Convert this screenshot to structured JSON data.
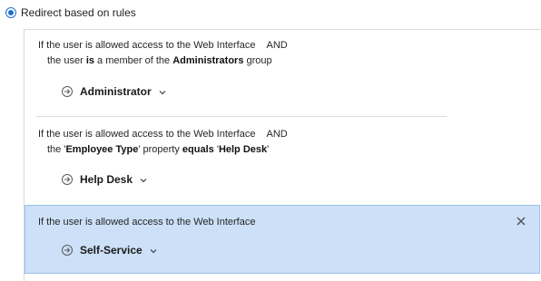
{
  "option": {
    "label": "Redirect based on rules",
    "selected": true
  },
  "rules": [
    {
      "line1": "If the user is allowed access to the Web Interface",
      "conj": "AND",
      "line2_parts": [
        "the user ",
        "is",
        " a member of the ",
        "Administrators",
        " group"
      ],
      "target": "Administrator"
    },
    {
      "line1": "If the user is allowed access to the Web Interface",
      "conj": "AND",
      "line2_parts": [
        "the '",
        "Employee Type",
        "' property ",
        "equals",
        " '",
        "Help Desk",
        "'"
      ],
      "target": "Help Desk"
    },
    {
      "line1": "If the user is allowed access to the Web Interface",
      "target": "Self-Service",
      "selected": true
    }
  ],
  "colors": {
    "accent": "#1f6fd1",
    "selected_bg": "#cce0f7",
    "selected_border": "#9cc1ea"
  }
}
